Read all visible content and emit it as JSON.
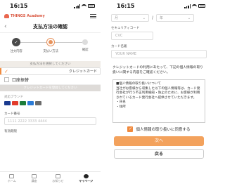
{
  "left": {
    "status": {
      "time": "16:15"
    },
    "logo": {
      "text": "THINGS Academy"
    },
    "title": "支払方法の確認",
    "back_glyph": "‹",
    "steps": [
      {
        "label": "注文内容",
        "state": "done",
        "glyph": "✓"
      },
      {
        "label": "支払い方法",
        "state": "current",
        "glyph": ""
      },
      {
        "label": "確認",
        "state": "todo",
        "glyph": ""
      }
    ],
    "section_title": "支払方法を選択してください",
    "options": [
      {
        "label": "クレジットカード",
        "selected": true
      },
      {
        "label": "口座振替",
        "selected": false
      }
    ],
    "gray_note": "クレジットカードを登録してください",
    "brands_label": "対応ブランド",
    "card_brands": [
      {
        "name": "visa-icon",
        "color": "#1a3a8f"
      },
      {
        "name": "mastercard-icon",
        "color": "#e23b2b"
      },
      {
        "name": "jcb-icon",
        "color": "#1c7c3a"
      },
      {
        "name": "amex-icon",
        "color": "#2b7bd6"
      },
      {
        "name": "diners-icon",
        "color": "#6b6b6b"
      }
    ],
    "card_number_label": "カード番号",
    "card_number_placeholder": "1111 2222 3333 4444",
    "expiry_label": "有効期限",
    "tabs": [
      {
        "label": "ホーム",
        "icon": "home-icon",
        "active": false
      },
      {
        "label": "講座",
        "icon": "book-icon",
        "active": false
      },
      {
        "label": "お知らせ",
        "icon": "bell-icon",
        "active": false
      },
      {
        "label": "マイページ",
        "icon": "user-icon",
        "active": true
      }
    ]
  },
  "right": {
    "status": {
      "time": "16:15"
    },
    "month_placeholder": "月",
    "year_placeholder": "年",
    "slash": "/",
    "security_label": "セキュリティコード",
    "security_placeholder": "CVC",
    "name_label": "カード名義",
    "name_placeholder": "YOUR NAME",
    "notice": "クレジットカードの利用にあたって、下記の個人情報の取り扱いに関する内容をご確認ください。",
    "policy_lines": [
      "■個人情報の取り扱いについて",
      "当社がお客様から収集した以下の個人情報等は、カード発行会社が行う不正利用検知・防止のために、お客様が利用されているカード発行会社へ提供させていただきます。",
      "・氏名",
      "・住所"
    ],
    "agree_label": "個人情報の取り扱いに同意する",
    "next_button": "次へ",
    "back_button": "戻る"
  },
  "colors": {
    "accent": "#f08a3e",
    "button": "#f3a25d",
    "logo": "#d9533c"
  }
}
